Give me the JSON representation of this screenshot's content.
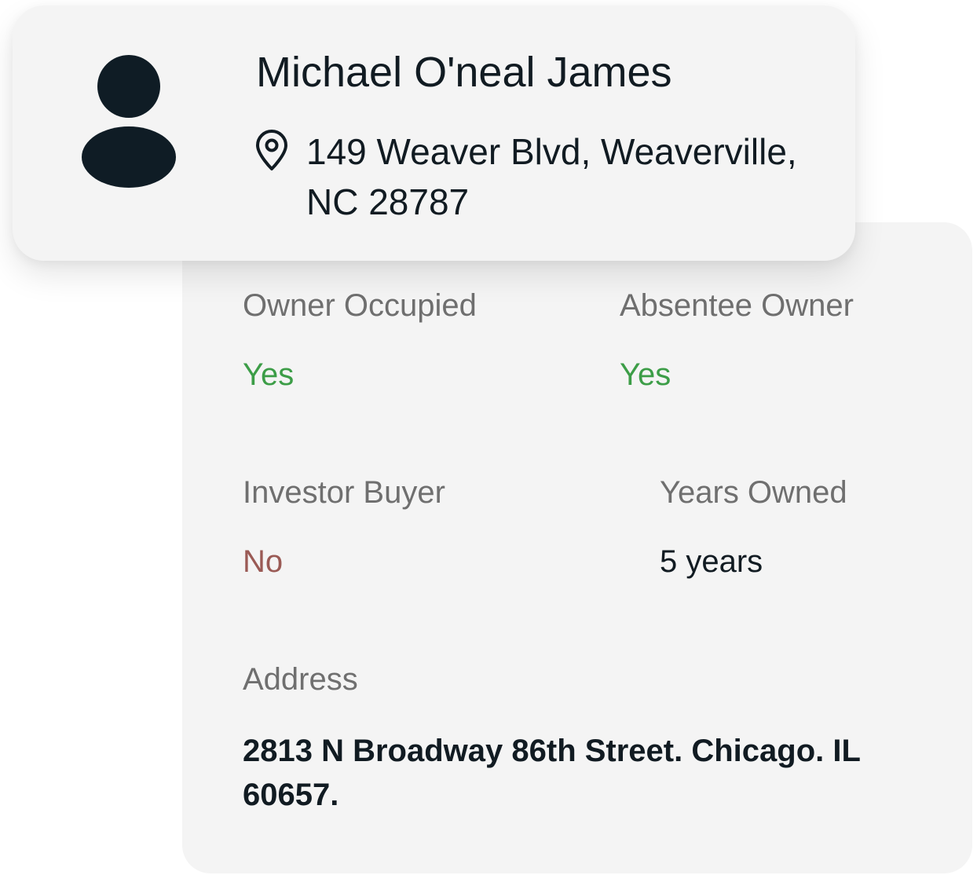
{
  "owner": {
    "name": "Michael O'neal James",
    "address": "149 Weaver Blvd, Weaverville, NC 28787",
    "avatar_icon": "person-icon",
    "location_icon": "map-pin-icon"
  },
  "details": {
    "owner_occupied": {
      "label": "Owner Occupied",
      "value": "Yes"
    },
    "absentee_owner": {
      "label": "Absentee Owner",
      "value": "Yes"
    },
    "investor_buyer": {
      "label": "Investor Buyer",
      "value": "No"
    },
    "years_owned": {
      "label": "Years Owned",
      "value": "5 years"
    },
    "address": {
      "label": "Address",
      "value": "2813 N Broadway 86th Street. Chicago. IL 60657."
    }
  },
  "colors": {
    "yes": "#3c9d47",
    "no": "#9a5a55",
    "dark": "#111b22",
    "label": "#6f6f6f",
    "card": "#f4f4f4"
  }
}
